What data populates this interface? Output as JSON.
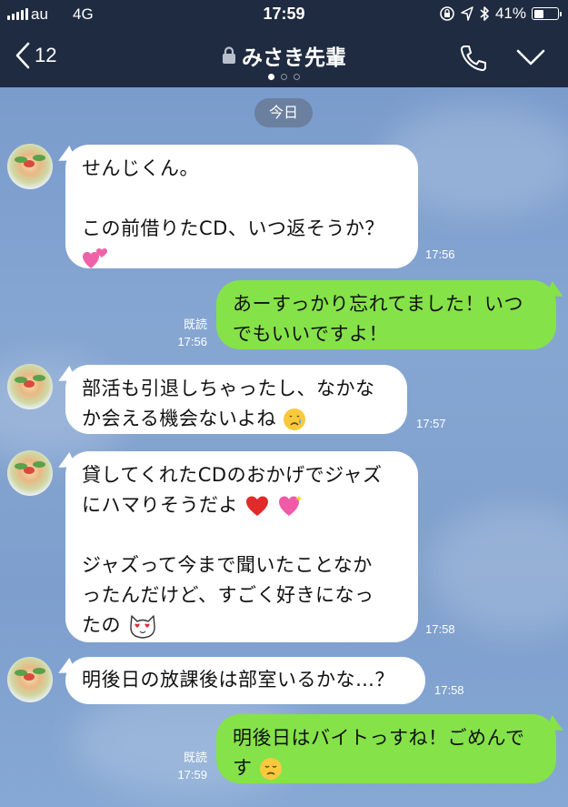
{
  "status_bar": {
    "carrier": "au",
    "network": "4G",
    "time": "17:59",
    "battery_percent": "41%",
    "battery_level": 0.41,
    "icons": [
      "signal-icon",
      "orientation-lock-icon",
      "location-arrow-icon",
      "bluetooth-icon",
      "battery-icon"
    ]
  },
  "header": {
    "back_count": "12",
    "title": "みさき先輩",
    "icons": [
      "back-chevron-icon",
      "lock-icon",
      "phone-icon",
      "chevron-down-icon"
    ]
  },
  "chat": {
    "date_label": "今日",
    "messages": [
      {
        "direction": "in",
        "lines": [
          "せんじくん。",
          "",
          "この前借りたCD、いつ返そうか？",
          ""
        ],
        "emoji": [
          "two-hearts-emoji"
        ],
        "time": "17:56"
      },
      {
        "direction": "out",
        "lines": [
          "あーすっかり忘れてました！いつ",
          "でもいいですよ！"
        ],
        "read": "既読",
        "time": "17:56"
      },
      {
        "direction": "in",
        "lines": [
          "部活も引退しちゃったし、なかな",
          "か会える機会ないよね"
        ],
        "emoji": [
          "crying-face-emoji"
        ],
        "time": "17:57"
      },
      {
        "direction": "in",
        "lines": [
          "貸してくれたCDのおかげでジャズ",
          "にハマりそうだよ",
          "",
          "ジャズって今まで聞いたことなか",
          "ったんだけど、すごく好きになっ",
          "たの"
        ],
        "emoji": [
          "red-heart-emoji",
          "sparkling-heart-emoji",
          "heart-eyes-cat-emoji"
        ],
        "time": "17:58"
      },
      {
        "direction": "in",
        "lines": [
          "明後日の放課後は部室いるかな…？"
        ],
        "time": "17:58"
      },
      {
        "direction": "out",
        "lines": [
          "明後日はバイトっすね！ごめんで",
          "す"
        ],
        "emoji": [
          "disappointed-face-emoji"
        ],
        "read": "既読",
        "time": "17:59"
      }
    ]
  },
  "colors": {
    "header_bg": "#1f2b40",
    "chat_bg": "#7e9fcd",
    "incoming_bubble": "#ffffff",
    "outgoing_bubble": "#85e249",
    "date_chip": "#6b7f9e"
  }
}
